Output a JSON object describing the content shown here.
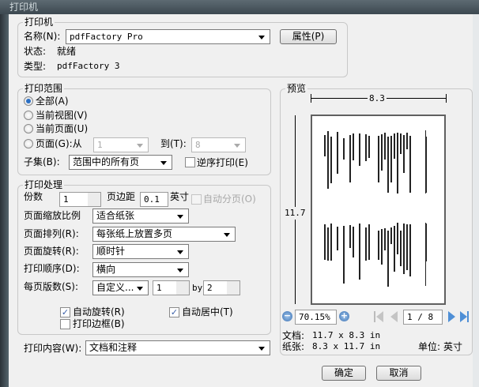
{
  "window": {
    "title": "打印机"
  },
  "printer": {
    "group_label": "打印机",
    "name_label": "名称(N):",
    "name_value": "pdfFactory Pro",
    "properties_button": "属性(P)",
    "status_label": "状态:",
    "status_value": "就绪",
    "type_label": "类型:",
    "type_value": "pdfFactory 3"
  },
  "range": {
    "group_label": "打印范围",
    "all": "全部(A)",
    "current_view": "当前视图(V)",
    "current_page": "当前页面(U)",
    "pages": "页面(G):从",
    "from_value": "1",
    "to_label": "到(T):",
    "to_value": "8",
    "subset_label": "子集(B):",
    "subset_value": "范围中的所有页",
    "reverse_label": "逆序打印(E)",
    "selected": "all"
  },
  "handling": {
    "group_label": "打印处理",
    "copies_label": "份数",
    "copies_value": "1",
    "margin_label": "页边距",
    "margin_value": "0.1",
    "margin_unit": "英寸",
    "auto_paginate": "自动分页(O)",
    "scaling_label": "页面缩放比例",
    "scaling_value": "适合纸张",
    "arrangement_label": "页面排列(R):",
    "arrangement_value": "每张纸上放置多页",
    "rotation_label": "页面旋转(R):",
    "rotation_value": "顺时针",
    "order_label": "打印顺序(D):",
    "order_value": "横向",
    "per_sheet_label": "每页版数(S):",
    "per_sheet_value": "自定义...",
    "per_sheet_cols": "1",
    "by_label": "by",
    "per_sheet_rows": "2",
    "auto_rotate": "自动旋转(R)",
    "auto_rotate_checked": true,
    "auto_center": "自动居中(T)",
    "auto_center_checked": true,
    "print_border": "打印边框(B)",
    "print_border_checked": false
  },
  "content": {
    "label": "打印内容(W):",
    "value": "文档和注释"
  },
  "preview": {
    "group_label": "预览",
    "width_dim": "8.3",
    "height_dim": "11.7",
    "zoom_value": "70.15%",
    "page_value": "1 / 8",
    "doc_label": "文档:",
    "doc_value": "11.7 x 8.3 in",
    "paper_label": "纸张:",
    "paper_value": "8.3 x 11.7 in",
    "unit_label": "单位:",
    "unit_value": "英寸"
  },
  "buttons": {
    "ok": "确定",
    "cancel": "取消"
  }
}
